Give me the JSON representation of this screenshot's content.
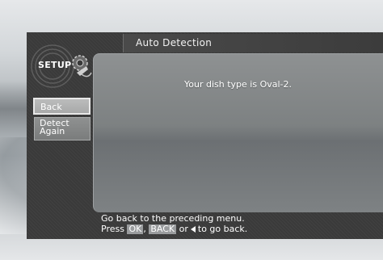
{
  "title_bar": {
    "title": "Auto Detection"
  },
  "setup_badge": {
    "label": "SETUP",
    "icon": "satellite-gear-icon"
  },
  "content": {
    "message": "Your dish type is Oval-2."
  },
  "sidebar": {
    "buttons": [
      {
        "label": "Back",
        "selected": true
      },
      {
        "label": "Detect\nAgain",
        "selected": false
      }
    ]
  },
  "help": {
    "line1": "Go back to the preceding menu.",
    "line2_prefix": "Press",
    "key_ok": "OK",
    "separator": ",",
    "key_back": "BACK",
    "or": "or",
    "arrow_icon": "left-arrow-icon",
    "suffix": "to go back."
  },
  "colors": {
    "frame": "#3a3a3a",
    "panel": "#7d8182",
    "selected_button": "#bbbcbc",
    "text": "#ffffff"
  }
}
